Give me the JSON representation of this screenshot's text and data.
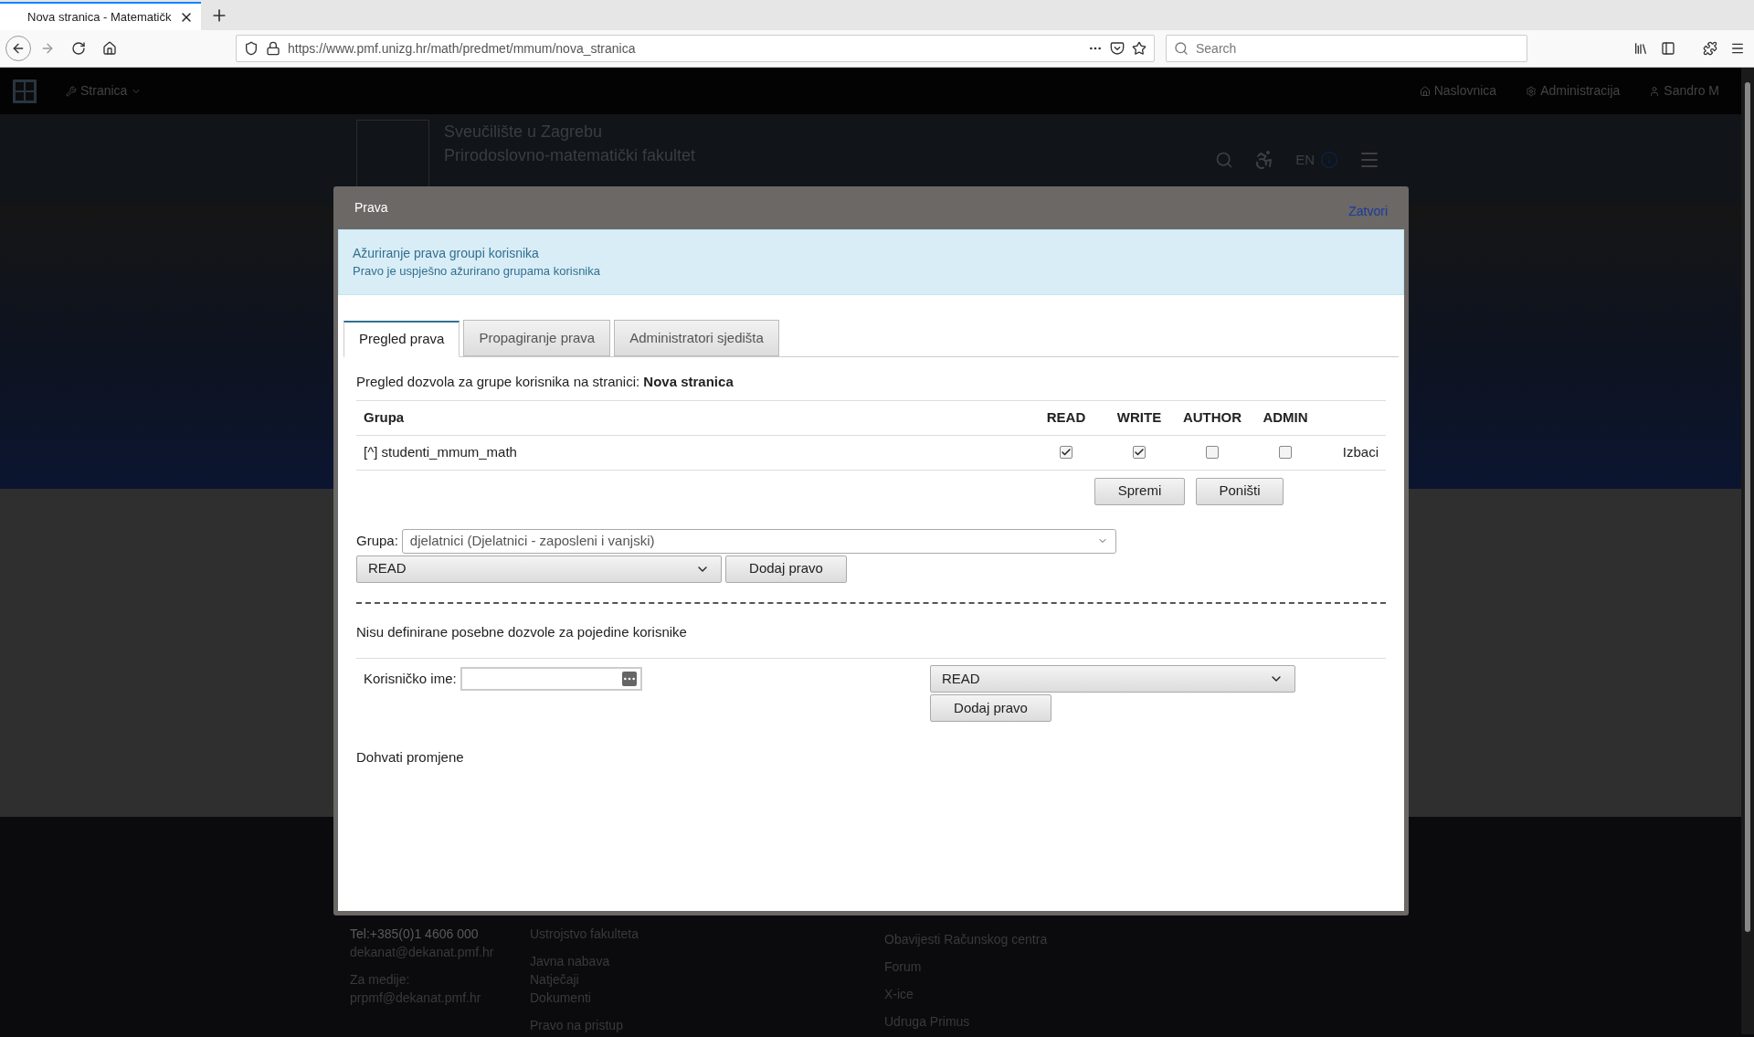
{
  "browser": {
    "tab_title": "Nova stranica - Matematičk",
    "url": "https://www.pmf.unizg.hr/math/predmet/mmum/nova_stranica",
    "search_placeholder": "Search"
  },
  "site": {
    "nav": {
      "menu": "Stranica",
      "links": [
        {
          "label": "Naslovnica",
          "kind": "home"
        },
        {
          "label": "Administracija",
          "kind": "gear"
        },
        {
          "label": "Sandro M",
          "kind": "user"
        }
      ]
    },
    "header": {
      "lines": [
        "Sveučilište u Zagrebu",
        "Prirodoslovno-matematički fakultet"
      ],
      "lang": "EN"
    },
    "footer": {
      "columns": [
        [
          "Tel:+385(0)1 4606 000",
          "dekanat@dekanat.pmf.hr",
          "",
          "Za medije:",
          "prpmf@dekanat.pmf.hr"
        ],
        [
          "Ustrojstvo fakulteta",
          "",
          "Javna nabava",
          "Natječaji",
          "Dokumenti",
          "",
          "Pravo na pristup"
        ],
        [
          "Obavijesti Računskog centra",
          "Forum",
          "X-ice",
          "Udruga Primus"
        ]
      ]
    }
  },
  "modal": {
    "title": "Prava",
    "close": "Zatvori",
    "alert": {
      "title": "Ažuriranje prava groupi korisnika",
      "message": "Pravo je uspješno ažurirano grupama korisnika"
    },
    "tabs": [
      {
        "label": "Pregled prava",
        "selected": true
      },
      {
        "label": "Propagiranje prava",
        "selected": false
      },
      {
        "label": "Administratori sjedišta",
        "selected": false
      }
    ],
    "intro": "Pregled dozvola za grupe korisnika na stranici: **Nova stranica**",
    "columns": [
      "Grupa",
      "READ",
      "WRITE",
      "AUTHOR",
      "ADMIN"
    ],
    "rows": [
      {
        "group": "[^] studenti_mmum_math",
        "read": true,
        "write": true,
        "author": false,
        "admin": false,
        "action": "Izbaci"
      }
    ],
    "save": "Spremi",
    "cancel": "Poništi",
    "group_label": "Grupa:",
    "group_value": "djelatnici (Djelatnici - zaposleni i vanjski)",
    "group_permission": "READ",
    "group_add": "Dodaj pravo",
    "user_note": "Nisu definirane posebne dozvole za pojedine korisnike",
    "username_label": "Korisničko ime:",
    "user_permission": "READ",
    "user_add": "Dodaj pravo",
    "changes_link": "Dohvati promjene"
  }
}
